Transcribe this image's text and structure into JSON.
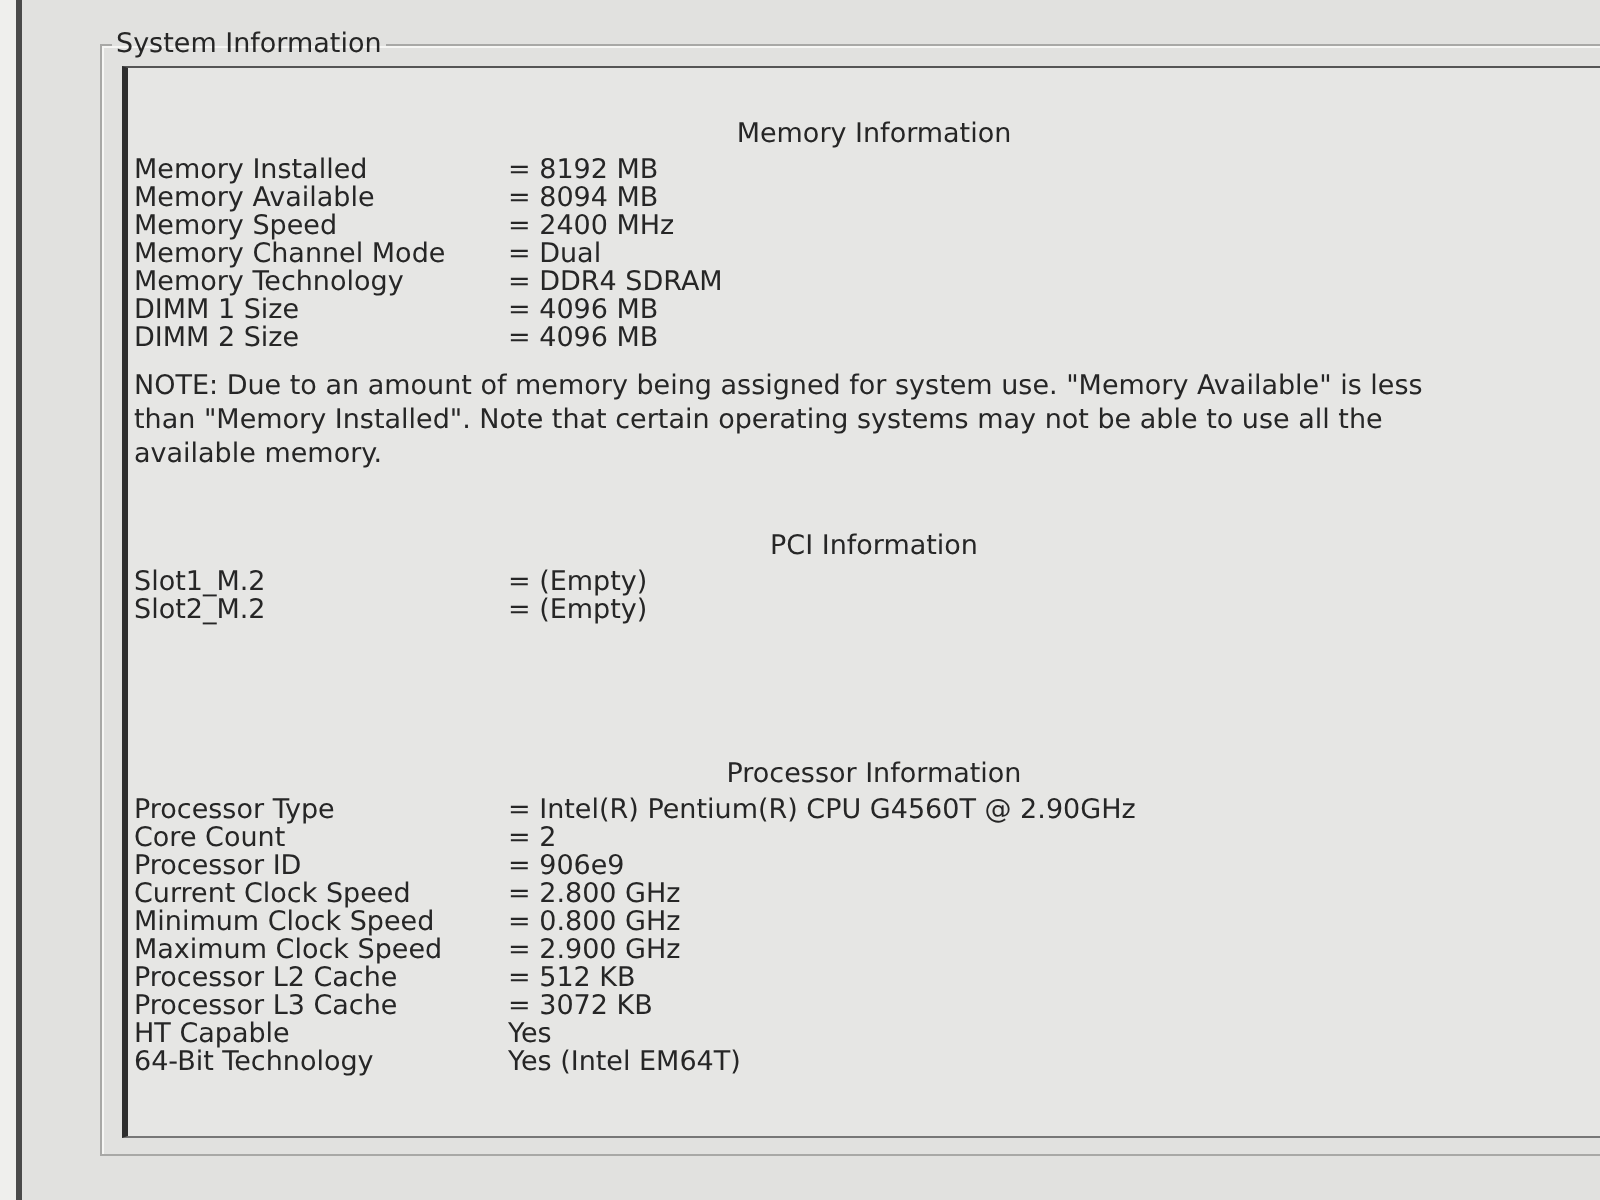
{
  "group_box": {
    "title": "System Information"
  },
  "sections": [
    {
      "heading": "Memory Information",
      "rows": [
        {
          "label": "Memory Installed",
          "value": "= 8192 MB"
        },
        {
          "label": "Memory Available",
          "value": "= 8094 MB"
        },
        {
          "label": "Memory Speed",
          "value": "= 2400 MHz"
        },
        {
          "label": "Memory Channel Mode",
          "value": "= Dual"
        },
        {
          "label": "Memory Technology",
          "value": "= DDR4 SDRAM"
        },
        {
          "label": "DIMM 1 Size",
          "value": "= 4096 MB"
        },
        {
          "label": "DIMM 2 Size",
          "value": "= 4096 MB"
        }
      ],
      "note": "NOTE: Due to an amount of memory being assigned for system use. \"Memory Available\" is less than \"Memory Installed\". Note that certain operating systems may not be able to use all the available memory."
    },
    {
      "heading": "PCI Information",
      "rows": [
        {
          "label": "Slot1_M.2",
          "value": "= (Empty)"
        },
        {
          "label": "Slot2_M.2",
          "value": "= (Empty)"
        }
      ]
    },
    {
      "heading": "Processor Information",
      "rows": [
        {
          "label": "Processor Type",
          "value": "= Intel(R) Pentium(R) CPU G4560T @ 2.90GHz"
        },
        {
          "label": "Core Count",
          "value": "= 2"
        },
        {
          "label": "Processor ID",
          "value": "= 906e9"
        },
        {
          "label": "Current Clock Speed",
          "value": "= 2.800 GHz"
        },
        {
          "label": "Minimum Clock Speed",
          "value": "= 0.800 GHz"
        },
        {
          "label": "Maximum Clock Speed",
          "value": "= 2.900 GHz"
        },
        {
          "label": "Processor L2 Cache",
          "value": "= 512 KB"
        },
        {
          "label": "Processor L3 Cache",
          "value": "= 3072 KB"
        },
        {
          "label": "HT Capable",
          "value": "Yes"
        },
        {
          "label": "64-Bit Technology",
          "value": "Yes (Intel EM64T)"
        }
      ]
    }
  ]
}
